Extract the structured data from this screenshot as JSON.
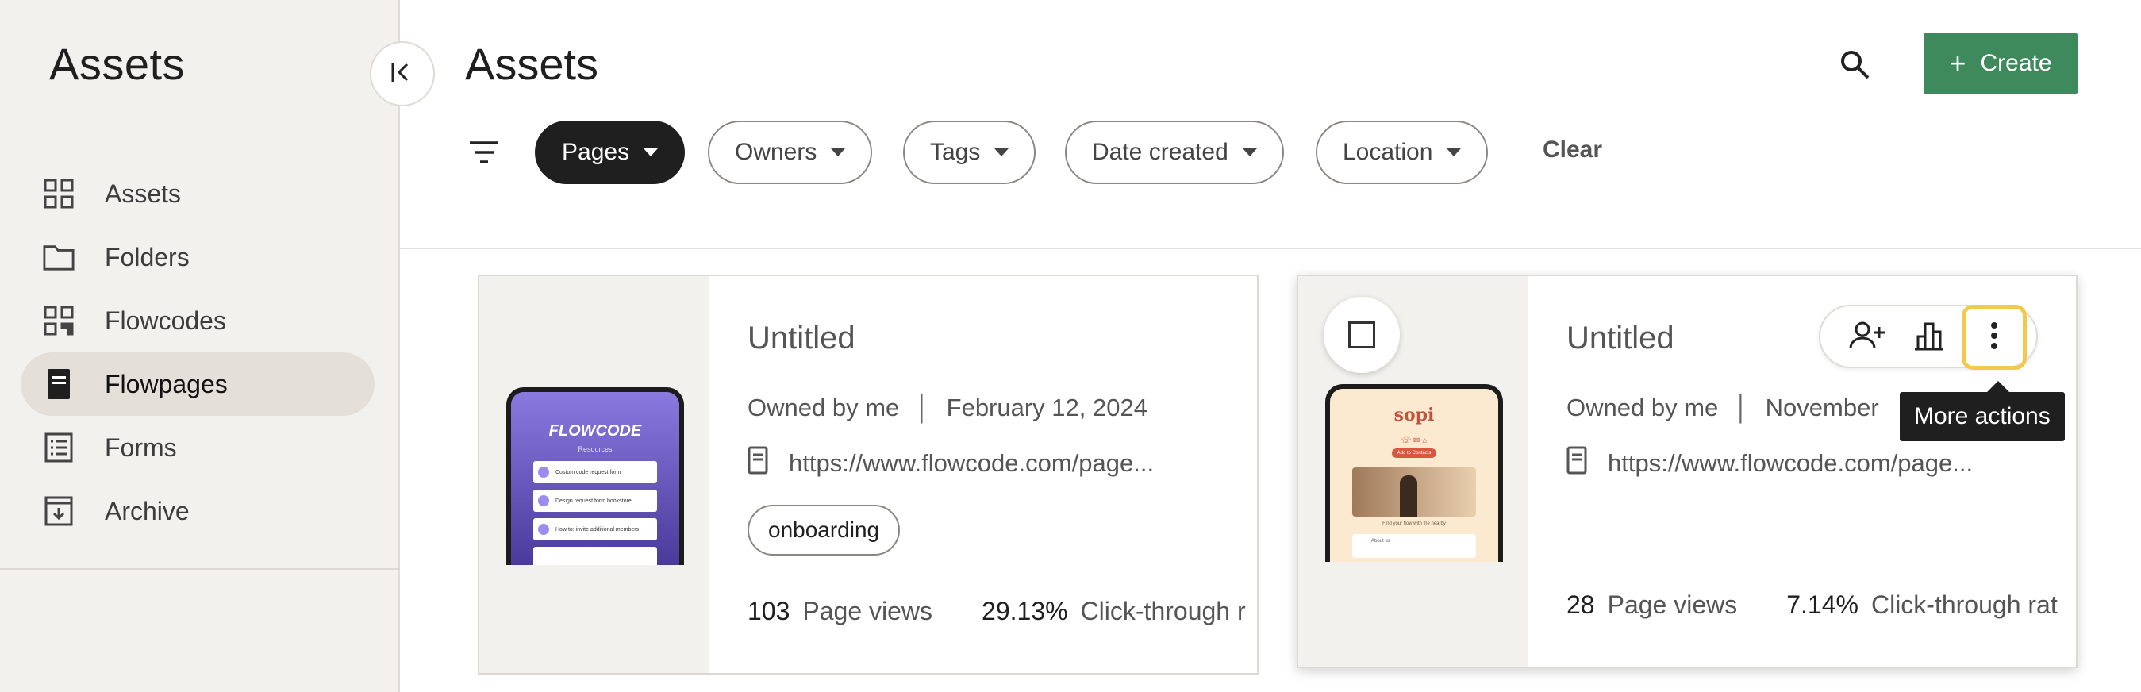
{
  "sidebar": {
    "title": "Assets",
    "items": [
      {
        "label": "Assets",
        "icon": "grid-icon"
      },
      {
        "label": "Folders",
        "icon": "folder-icon"
      },
      {
        "label": "Flowcodes",
        "icon": "qr-code-icon"
      },
      {
        "label": "Flowpages",
        "icon": "page-icon",
        "active": true
      },
      {
        "label": "Forms",
        "icon": "form-icon"
      },
      {
        "label": "Archive",
        "icon": "archive-icon"
      }
    ]
  },
  "header": {
    "title": "Assets",
    "create_label": "Create"
  },
  "filters": {
    "chips": [
      "Pages",
      "Owners",
      "Tags",
      "Date created",
      "Location"
    ],
    "active": "Pages",
    "clear_label": "Clear"
  },
  "cards": [
    {
      "title": "Untitled",
      "owner": "Owned by me",
      "date": "February 12, 2024",
      "url": "https://www.flowcode.com/page...",
      "tag": "onboarding",
      "page_views": "103",
      "page_views_label": "Page views",
      "ctr": "29.13%",
      "ctr_label": "Click-through r",
      "thumb": {
        "brand": "FLOWCODE",
        "subtitle": "Resources",
        "links": [
          "Custom code request form",
          "Design request form bookstore",
          "How to: invite additional members"
        ]
      }
    },
    {
      "title": "Untitled",
      "owner": "Owned by me",
      "date": "November",
      "url": "https://www.flowcode.com/page...",
      "page_views": "28",
      "page_views_label": "Page views",
      "ctr": "7.14%",
      "ctr_label": "Click-through rat",
      "thumb": {
        "brand": "sopi",
        "button": "Add to Contacts",
        "caption": "Find your flow with the nearby",
        "about": "About us"
      }
    }
  ],
  "tooltip": "More actions",
  "colors": {
    "accent": "#3f8a5c",
    "highlight": "#f2c94c",
    "sidebar_bg": "#f3f1ee"
  }
}
